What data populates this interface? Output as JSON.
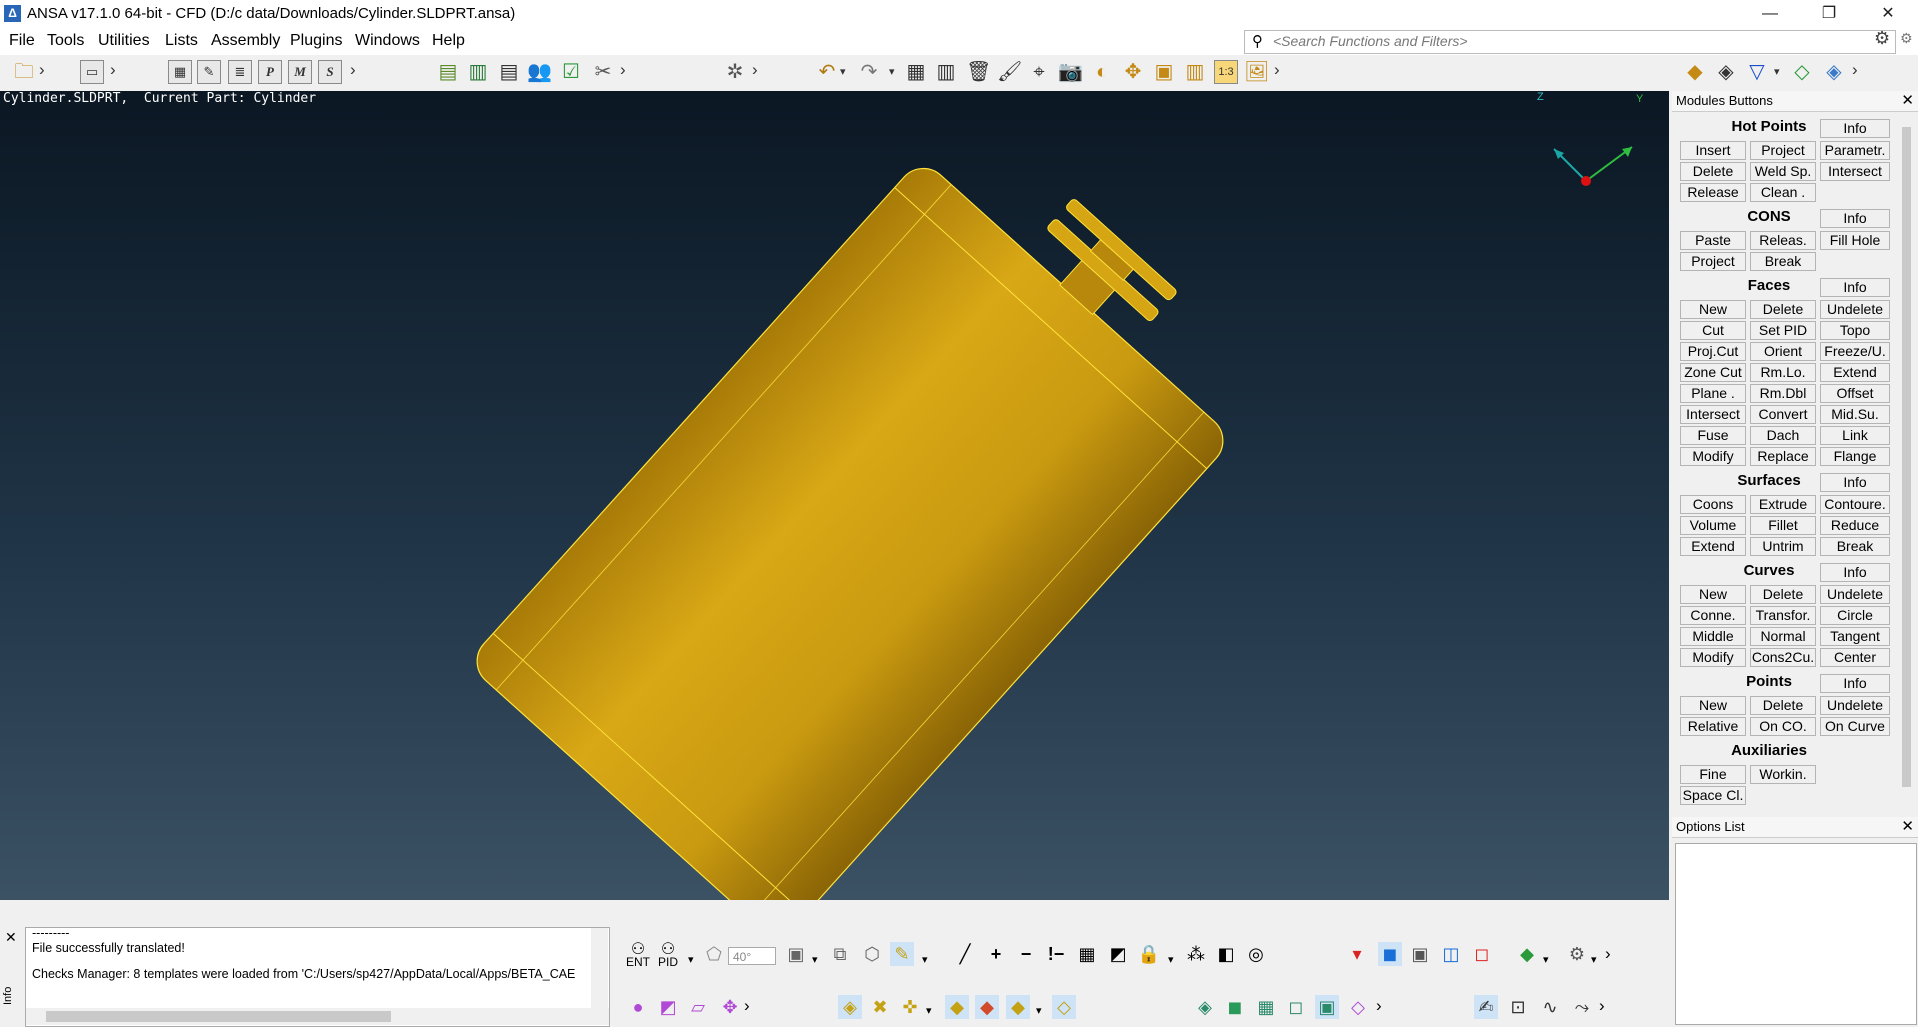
{
  "window": {
    "title": "ANSA v17.1.0 64-bit - CFD (D:/c data/Downloads/Cylinder.SLDPRT.ansa)",
    "minimize": "—",
    "restore": "❐",
    "close": "✕"
  },
  "menu": [
    "File",
    "Tools",
    "Utilities",
    "Lists",
    "Assembly",
    "Plugins",
    "Windows",
    "Help"
  ],
  "search": {
    "placeholder": "<Search Functions and Filters>"
  },
  "viewport": {
    "info": "Cylinder.SLDPRT,  Current Part: Cylinder",
    "axes": {
      "z": "Z",
      "y": "Y"
    },
    "model_color": "#d4a514"
  },
  "modules_panel": {
    "title": "Modules Buttons",
    "sections": [
      {
        "title": "Hot Points",
        "info": "Info",
        "rows": [
          [
            "Insert",
            "Project",
            "Parametr."
          ],
          [
            "Delete",
            "Weld Sp.",
            "Intersect"
          ],
          [
            "Release",
            "Clean ."
          ]
        ]
      },
      {
        "title": "CONS",
        "info": "Info",
        "rows": [
          [
            "Paste",
            "Releas.",
            "Fill Hole"
          ],
          [
            "Project",
            "Break"
          ]
        ]
      },
      {
        "title": "Faces",
        "info": "Info",
        "rows": [
          [
            "New",
            "Delete",
            "Undelete"
          ],
          [
            "Cut",
            "Set PID",
            "Topo"
          ],
          [
            "Proj.Cut",
            "Orient",
            "Freeze/U."
          ],
          [
            "Zone Cut",
            "Rm.Lo.",
            "Extend"
          ],
          [
            "Plane .",
            "Rm.Dbl",
            "Offset"
          ],
          [
            "Intersect",
            "Convert",
            "Mid.Su."
          ],
          [
            "Fuse",
            "Dach",
            "Link"
          ],
          [
            "Modify",
            "Replace",
            "Flange"
          ]
        ]
      },
      {
        "title": "Surfaces",
        "info": "Info",
        "rows": [
          [
            "Coons",
            "Extrude",
            "Contoure."
          ],
          [
            "Volume",
            "Fillet",
            "Reduce"
          ],
          [
            "Extend",
            "Untrim",
            "Break"
          ]
        ]
      },
      {
        "title": "Curves",
        "info": "Info",
        "rows": [
          [
            "New",
            "Delete",
            "Undelete"
          ],
          [
            "Conne.",
            "Transfor.",
            "Circle"
          ],
          [
            "Middle",
            "Normal",
            "Tangent"
          ],
          [
            "Modify",
            "Cons2Cu.",
            "Center"
          ]
        ]
      },
      {
        "title": "Points",
        "info": "Info",
        "rows": [
          [
            "New",
            "Delete",
            "Undelete"
          ],
          [
            "Relative",
            "On CO.",
            "On Curve"
          ]
        ]
      },
      {
        "title": "Auxiliaries",
        "rows": [
          [
            "Fine",
            "Workin."
          ],
          [
            "Space Cl."
          ]
        ]
      }
    ]
  },
  "options_panel": {
    "title": "Options List"
  },
  "log": {
    "lines": [
      "---------",
      "File successfully translated!",
      "",
      "Checks Manager: 8 templates were loaded from 'C:/Users/sp427/AppData/Local/Apps/BETA_CAE"
    ],
    "tab": "Info"
  },
  "bottom_toolbar": {
    "angle_value": "40°",
    "ent_label": "ENT",
    "pid_label": "PID"
  },
  "toolbar_labels": {
    "p": "P",
    "m": "M",
    "s": "S",
    "scale": "1:3"
  }
}
